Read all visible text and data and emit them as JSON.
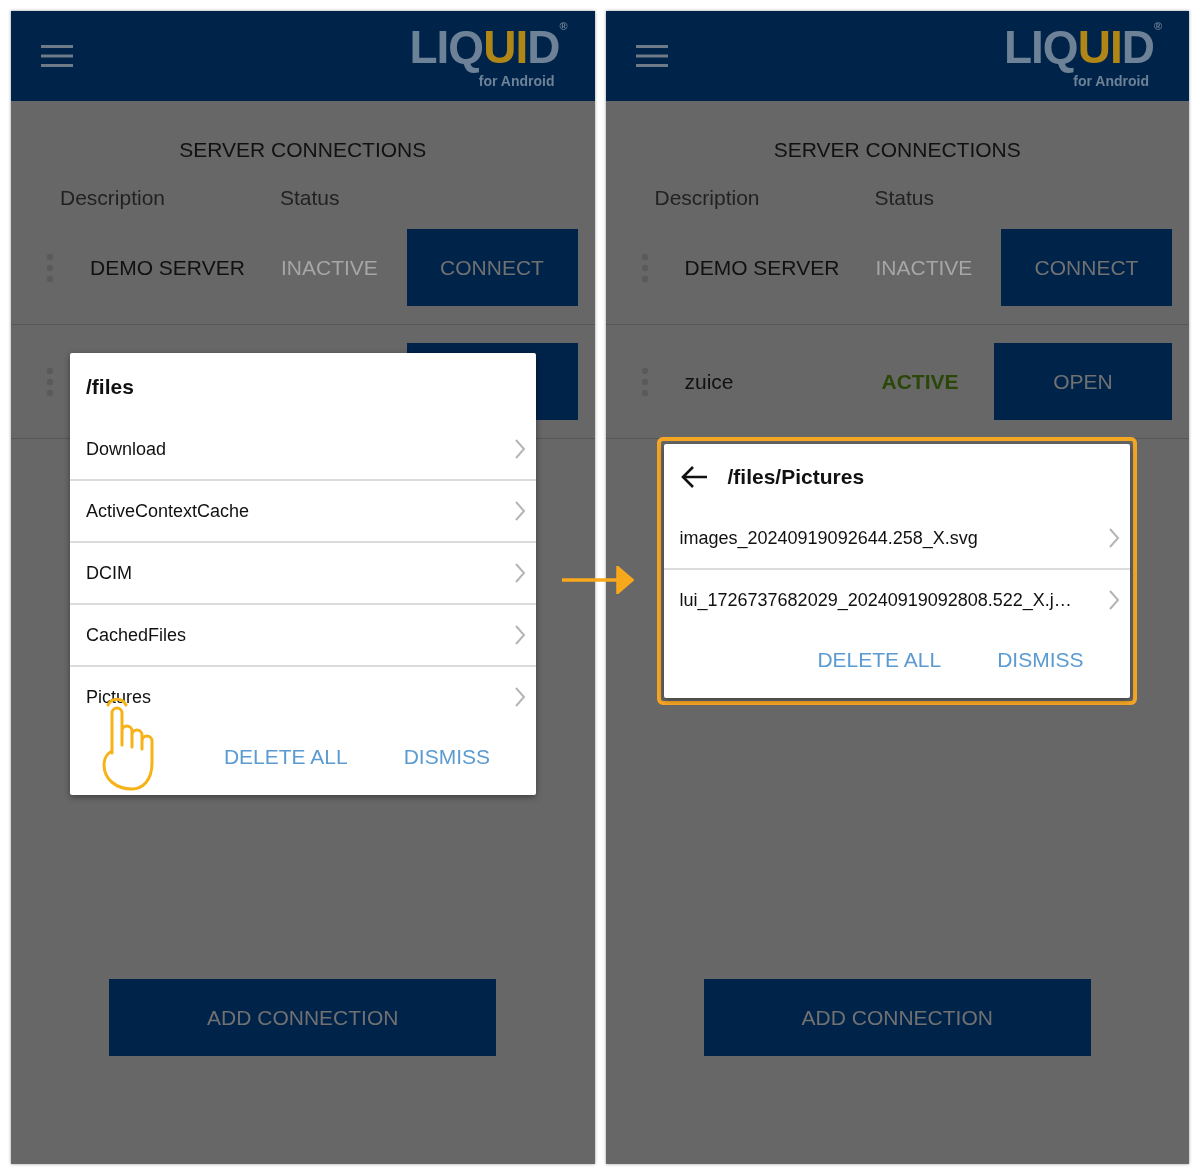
{
  "panels": [
    {
      "header": {
        "logo_parts": [
          {
            "text": "LIQ",
            "accent": false
          },
          {
            "text": "UI",
            "accent": true
          },
          {
            "text": "D",
            "accent": false
          }
        ],
        "registered": "®",
        "subtitle": "for Android"
      },
      "title": "SERVER CONNECTIONS",
      "columns": [
        "Description",
        "Status"
      ],
      "servers": [
        {
          "kind": "row",
          "name": "DEMO SERVER",
          "status": "INACTIVE",
          "active": false,
          "action": "CONNECT"
        },
        {
          "kind": "covered"
        }
      ],
      "dialog": {
        "highlighted": false,
        "back_arrow": false,
        "title": "/files",
        "items": [
          {
            "label": "Download",
            "tapped": false
          },
          {
            "label": "ActiveContextCache",
            "tapped": false
          },
          {
            "label": "DCIM",
            "tapped": false
          },
          {
            "label": "CachedFiles",
            "tapped": false
          },
          {
            "label": "Pictures",
            "tapped": true
          }
        ],
        "buttons": [
          "DELETE ALL",
          "DISMISS"
        ]
      },
      "add_button": "ADD CONNECTION"
    },
    {
      "header": {
        "logo_parts": [
          {
            "text": "LIQ",
            "accent": false
          },
          {
            "text": "UI",
            "accent": true
          },
          {
            "text": "D",
            "accent": false
          }
        ],
        "registered": "®",
        "subtitle": "for Android"
      },
      "title": "SERVER CONNECTIONS",
      "columns": [
        "Description",
        "Status"
      ],
      "servers": [
        {
          "kind": "row",
          "name": "DEMO SERVER",
          "status": "INACTIVE",
          "active": false,
          "action": "CONNECT"
        },
        {
          "kind": "row",
          "name": "zuice",
          "status": "ACTIVE",
          "active": true,
          "action": "OPEN"
        }
      ],
      "dialog": {
        "highlighted": true,
        "back_arrow": true,
        "title": "/files/Pictures",
        "items": [
          {
            "label": "images_20240919092644.258_X.svg",
            "tapped": false
          },
          {
            "label": "lui_1726737682029_20240919092808.522_X.j…",
            "tapped": false
          }
        ],
        "buttons": [
          "DELETE ALL",
          "DISMISS"
        ]
      },
      "add_button": "ADD CONNECTION"
    }
  ]
}
